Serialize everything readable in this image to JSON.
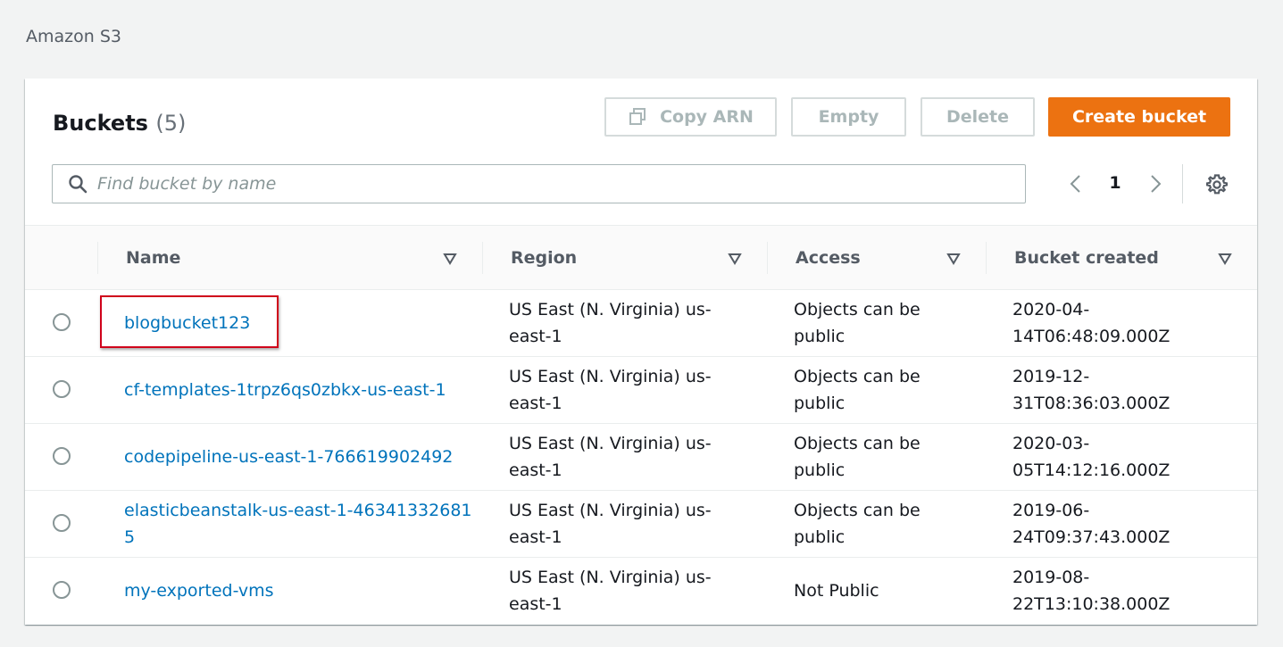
{
  "breadcrumb": "Amazon S3",
  "panel": {
    "title": "Buckets",
    "count": "(5)"
  },
  "toolbar": {
    "copy_arn_label": "Copy ARN",
    "empty_label": "Empty",
    "delete_label": "Delete",
    "create_label": "Create bucket"
  },
  "search": {
    "placeholder": "Find bucket by name",
    "value": ""
  },
  "pagination": {
    "current_page": "1"
  },
  "table": {
    "columns": [
      "Name",
      "Region",
      "Access",
      "Bucket created"
    ],
    "rows": [
      {
        "name": "blogbucket123",
        "region": "US East (N. Virginia) us-east-1",
        "access": "Objects can be public",
        "created": "2020-04-14T06:48:09.000Z"
      },
      {
        "name": "cf-templates-1trpz6qs0zbkx-us-east-1",
        "region": "US East (N. Virginia) us-east-1",
        "access": "Objects can be public",
        "created": "2019-12-31T08:36:03.000Z"
      },
      {
        "name": "codepipeline-us-east-1-766619902492",
        "region": "US East (N. Virginia) us-east-1",
        "access": "Objects can be public",
        "created": "2020-03-05T14:12:16.000Z"
      },
      {
        "name": "elasticbeanstalk-us-east-1-463413326815",
        "region": "US East (N. Virginia) us-east-1",
        "access": "Objects can be public",
        "created": "2019-06-24T09:37:43.000Z"
      },
      {
        "name": "my-exported-vms",
        "region": "US East (N. Virginia) us-east-1",
        "access": "Not Public",
        "created": "2019-08-22T13:10:38.000Z"
      }
    ]
  },
  "colors": {
    "accent": "#ec7211",
    "link": "#0073bb",
    "highlight": "#d0021b"
  },
  "icons": {
    "copy": "copy-icon",
    "search": "search-icon",
    "prev": "chevron-left-icon",
    "next": "chevron-right-icon",
    "settings": "gear-icon",
    "sort": "caret-down-icon"
  }
}
